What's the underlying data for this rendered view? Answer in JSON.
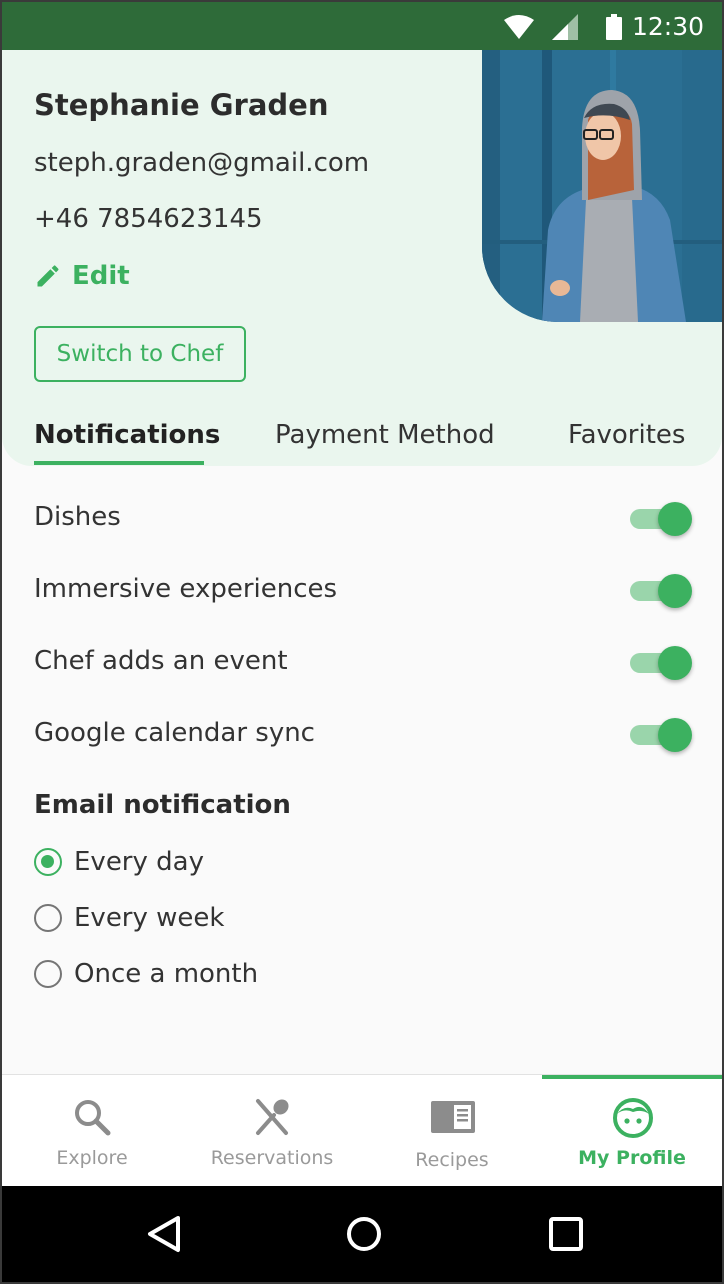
{
  "status_bar": {
    "time": "12:30"
  },
  "profile": {
    "name": "Stephanie Graden",
    "email": "steph.graden@gmail.com",
    "phone": "+46 7854623145",
    "edit_label": "Edit",
    "switch_label": "Switch to Chef"
  },
  "tabs": [
    {
      "label": "Notifications",
      "active": true
    },
    {
      "label": "Payment Method",
      "active": false
    },
    {
      "label": "Favorites",
      "active": false
    }
  ],
  "notifications": [
    {
      "label": "Dishes",
      "enabled": true
    },
    {
      "label": "Immersive experiences",
      "enabled": true
    },
    {
      "label": "Chef adds an event",
      "enabled": true
    },
    {
      "label": "Google calendar sync",
      "enabled": true
    }
  ],
  "email_notification": {
    "title": "Email notification",
    "options": [
      {
        "label": "Every day",
        "selected": true
      },
      {
        "label": "Every week",
        "selected": false
      },
      {
        "label": "Once a month",
        "selected": false
      }
    ]
  },
  "bottom_nav": [
    {
      "label": "Explore",
      "icon": "search-icon",
      "active": false
    },
    {
      "label": "Reservations",
      "icon": "cutlery-icon",
      "active": false
    },
    {
      "label": "Recipes",
      "icon": "book-icon",
      "active": false
    },
    {
      "label": "My Profile",
      "icon": "face-icon",
      "active": true
    }
  ],
  "colors": {
    "accent": "#3cb160",
    "status_bar": "#2e6b39",
    "header_bg": "#eaf6ee"
  }
}
